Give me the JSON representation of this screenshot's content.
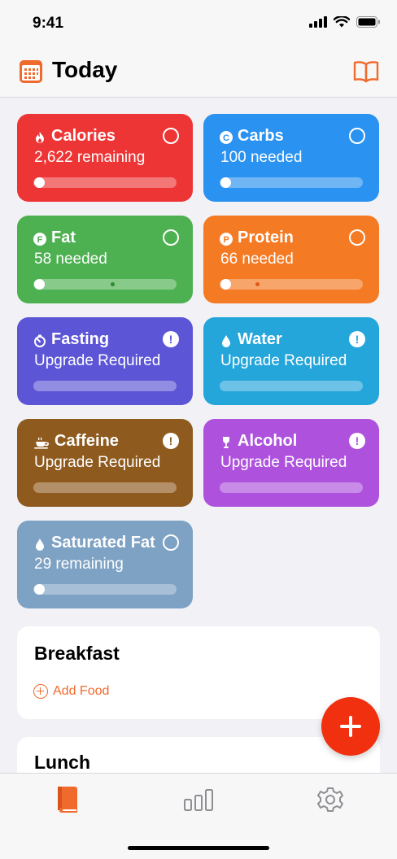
{
  "status_bar": {
    "time": "9:41"
  },
  "header": {
    "title": "Today"
  },
  "tiles": [
    {
      "name": "Calories",
      "sub": "2,622 remaining",
      "color": "#ee3535",
      "icon": "flame-icon",
      "state": "circle",
      "progress": 0
    },
    {
      "name": "Carbs",
      "sub": "100 needed",
      "color": "#2a92f0",
      "icon": "carbs-c-icon",
      "state": "circle",
      "progress": 0
    },
    {
      "name": "Fat",
      "sub": "58 needed",
      "color": "#4db051",
      "icon": "fat-f-icon",
      "state": "circle",
      "progress": 0
    },
    {
      "name": "Protein",
      "sub": "66 needed",
      "color": "#f57a24",
      "icon": "protein-p-icon",
      "state": "circle",
      "progress": 0
    },
    {
      "name": "Fasting",
      "sub": "Upgrade Required",
      "color": "#5c55d6",
      "icon": "timer-icon",
      "state": "warning"
    },
    {
      "name": "Water",
      "sub": "Upgrade Required",
      "color": "#24a6db",
      "icon": "drop-icon",
      "state": "warning"
    },
    {
      "name": "Caffeine",
      "sub": "Upgrade Required",
      "color": "#8e5a1e",
      "icon": "cup-icon",
      "state": "warning"
    },
    {
      "name": "Alcohol",
      "sub": "Upgrade Required",
      "color": "#ae52dd",
      "icon": "wine-glass-icon",
      "state": "warning"
    },
    {
      "name": "Saturated Fat",
      "sub": "29 remaining",
      "color": "#7ea2c4",
      "icon": "drop-icon",
      "state": "circle",
      "progress": 0
    }
  ],
  "meals": [
    {
      "title": "Breakfast",
      "add_label": "Add Food"
    },
    {
      "title": "Lunch"
    }
  ],
  "warning_glyph": "!",
  "tabbar": {
    "items": [
      "diary-tab",
      "stats-tab",
      "settings-tab"
    ],
    "active": "diary-tab"
  },
  "colors": {
    "accent": "#f06a2c",
    "fab": "#f1300f"
  }
}
